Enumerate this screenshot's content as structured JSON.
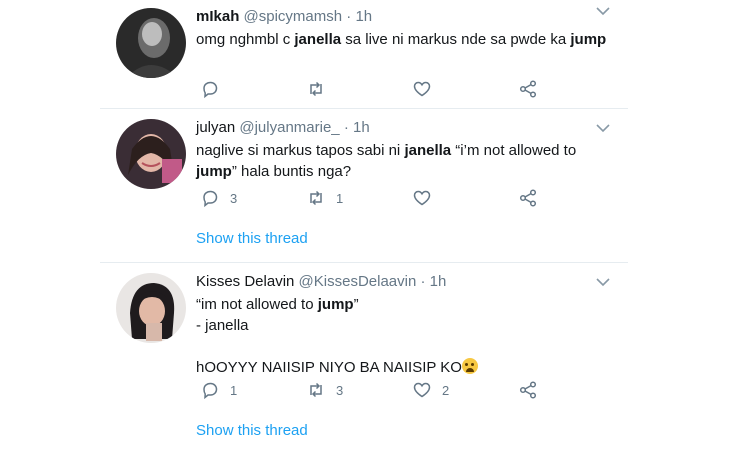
{
  "tweets": [
    {
      "name": "mIkah",
      "handle": "@spicymamsh",
      "time": "· 1h",
      "text_segments": [
        {
          "text": "omg nghmbl c ",
          "bold": false
        },
        {
          "text": "janella",
          "bold": true
        },
        {
          "text": " sa live ni markus nde sa pwde ka ",
          "bold": false
        },
        {
          "text": "jump",
          "bold": true
        }
      ],
      "reply_count": "",
      "retweet_count": "",
      "like_count": "",
      "show_thread": ""
    },
    {
      "name": "julyan",
      "handle": "@julyanmarie_",
      "time": "· 1h",
      "text_segments": [
        {
          "text": "naglive si markus tapos sabi ni ",
          "bold": false
        },
        {
          "text": "janella",
          "bold": true
        },
        {
          "text": " “i’m not allowed to ",
          "bold": false
        },
        {
          "text": "jump",
          "bold": true
        },
        {
          "text": "” hala buntis nga?",
          "bold": false
        }
      ],
      "reply_count": "3",
      "retweet_count": "1",
      "like_count": "",
      "show_thread": "Show this thread"
    },
    {
      "name": "Kisses Delavin",
      "handle": "@KissesDelaavin",
      "time": "· 1h",
      "text_line1_prefix": "“im not allowed to ",
      "text_line1_bold": "jump",
      "text_line1_suffix": "”",
      "text_line2": "- janella",
      "text_line3": "hOOYYY NAIISIP NIYO BA NAIISIP KO",
      "emoji_name": "crying-face-emoji",
      "reply_count": "1",
      "retweet_count": "3",
      "like_count": "2",
      "show_thread": "Show this thread"
    }
  ],
  "icons": {
    "reply": "reply-icon",
    "retweet": "retweet-icon",
    "like": "heart-icon",
    "share": "share-icon",
    "more": "chevron-down-icon"
  },
  "colors": {
    "link": "#1da1f2",
    "meta": "#657786",
    "divider": "#e6ecf0"
  }
}
